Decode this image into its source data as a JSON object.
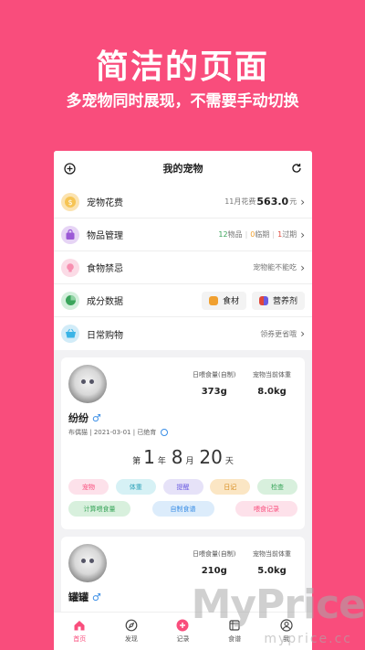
{
  "hero": {
    "title": "简洁的页面",
    "subtitle": "多宠物同时展现，不需要手动切换"
  },
  "topbar": {
    "title": "我的宠物"
  },
  "menu": [
    {
      "label": "宠物花费",
      "right_prefix": "11月花费",
      "right_value": "563.0",
      "right_suffix": "元",
      "icon": "coin-icon",
      "color": "#f6c453"
    },
    {
      "label": "物品管理",
      "right": {
        "normal_count": "12",
        "normal_label": "物品",
        "warn_count": "0",
        "warn_label": "临期",
        "expired_count": "1",
        "expired_label": "过期"
      },
      "icon": "bag-icon",
      "color": "#9b59d6"
    },
    {
      "label": "食物禁忌",
      "right_text": "宠物能不能吃",
      "icon": "bulb-icon",
      "color": "#f78fb0"
    },
    {
      "label": "成分数据",
      "btn1": "食材",
      "btn2": "营养剂",
      "icon": "pie-icon",
      "color": "#3aa55b"
    },
    {
      "label": "日常购物",
      "right_text": "领券更省哦",
      "icon": "basket-icon",
      "color": "#3ab4e6"
    }
  ],
  "pets": [
    {
      "name": "纷纷",
      "sex": "♂",
      "breed": "布偶猫",
      "birth": "2021-03-01",
      "status": "已绝育",
      "feed_label": "日喂食量(自制)",
      "feed_value": "373g",
      "weight_label": "宠物当前体重",
      "weight_value": "8.0kg",
      "age_prefix": "第",
      "years": "1",
      "year_label": "年",
      "months": "8",
      "month_label": "月",
      "days": "20",
      "day_label": "天",
      "tags": [
        "宠物",
        "体重",
        "提醒",
        "日记",
        "检查"
      ],
      "tags2": [
        "计算喂食量",
        "自制食谱",
        "喂食记录"
      ]
    },
    {
      "name": "罐罐",
      "sex": "♂",
      "feed_label": "日喂食量(自制)",
      "feed_value": "210g",
      "weight_label": "宠物当前体重",
      "weight_value": "5.0kg"
    }
  ],
  "tabbar": [
    {
      "label": "首页",
      "icon": "home-icon",
      "active": true
    },
    {
      "label": "发现",
      "icon": "compass-icon"
    },
    {
      "label": "记录",
      "icon": "plus-circle-icon"
    },
    {
      "label": "食谱",
      "icon": "recipe-icon"
    },
    {
      "label": "我",
      "icon": "user-icon"
    }
  ],
  "watermark": {
    "text": "MyPrice",
    "sub": "myprice.cc"
  },
  "colors": {
    "brand": "#f94d7c",
    "green": "#3aa55b",
    "orange": "#f0a030",
    "red": "#e0473a"
  }
}
